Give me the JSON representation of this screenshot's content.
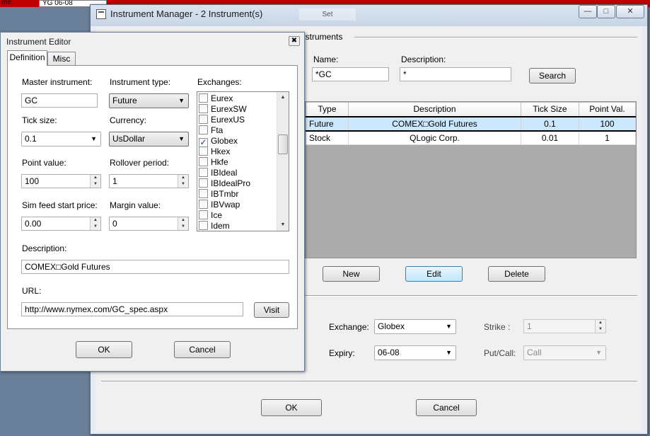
{
  "topbar": {
    "label": "me:",
    "field_value": "YG 06-08"
  },
  "main_window": {
    "title": "Instrument Manager - 2 Instrument(s)",
    "bg_tab_label": "Set",
    "section_title": "nstruments",
    "search": {
      "name_label": "Name:",
      "name_value": "*GC",
      "description_label": "Description:",
      "description_value": "*",
      "search_button": "Search"
    },
    "table": {
      "columns": [
        "Type",
        "Description",
        "Tick Size",
        "Point Val."
      ],
      "rows": [
        {
          "type": "Future",
          "description": "COMEX□Gold Futures",
          "tick_size": "0.1",
          "point_val": "100",
          "selected": true
        },
        {
          "type": "Stock",
          "description": "QLogic Corp.",
          "tick_size": "0.01",
          "point_val": "1",
          "selected": false
        }
      ]
    },
    "buttons": {
      "new": "New",
      "edit": "Edit",
      "delete": "Delete",
      "ok": "OK",
      "cancel": "Cancel"
    },
    "detail": {
      "exchange_label": "Exchange:",
      "exchange_value": "Globex",
      "expiry_label": "Expiry:",
      "expiry_value": "06-08",
      "strike_label": "Strike :",
      "strike_value": "1",
      "putcall_label": "Put/Call:",
      "putcall_value": "Call"
    }
  },
  "editor": {
    "title": "Instrument Editor",
    "tabs": [
      "Definition",
      "Misc"
    ],
    "master_label": "Master instrument:",
    "master_value": "GC",
    "type_label": "Instrument type:",
    "type_value": "Future",
    "exchanges_label": "Exchanges:",
    "exchanges": [
      {
        "name": "Eurex",
        "checked": false
      },
      {
        "name": "EurexSW",
        "checked": false
      },
      {
        "name": "EurexUS",
        "checked": false
      },
      {
        "name": "Fta",
        "checked": false
      },
      {
        "name": "Globex",
        "checked": true
      },
      {
        "name": "Hkex",
        "checked": false
      },
      {
        "name": "Hkfe",
        "checked": false
      },
      {
        "name": "IBIdeal",
        "checked": false
      },
      {
        "name": "IBIdealPro",
        "checked": false
      },
      {
        "name": "IBTmbr",
        "checked": false
      },
      {
        "name": "IBVwap",
        "checked": false
      },
      {
        "name": "Ice",
        "checked": false
      },
      {
        "name": "Idem",
        "checked": false
      }
    ],
    "tick_label": "Tick size:",
    "tick_value": "0.1",
    "currency_label": "Currency:",
    "currency_value": "UsDollar",
    "point_label": "Point value:",
    "point_value": "100",
    "rollover_label": "Rollover period:",
    "rollover_value": "1",
    "sim_label": "Sim feed start price:",
    "sim_value": "0.00",
    "margin_label": "Margin value:",
    "margin_value": "0",
    "desc_label": "Description:",
    "desc_value": "COMEX□Gold Futures",
    "url_label": "URL:",
    "url_value": "http://www.nymex.com/GC_spec.aspx",
    "visit_button": "Visit",
    "ok_button": "OK",
    "cancel_button": "Cancel"
  },
  "colors": {
    "topbar": "#c00000",
    "selected_row": "#cce8ff",
    "grid_bg": "#ababab"
  }
}
